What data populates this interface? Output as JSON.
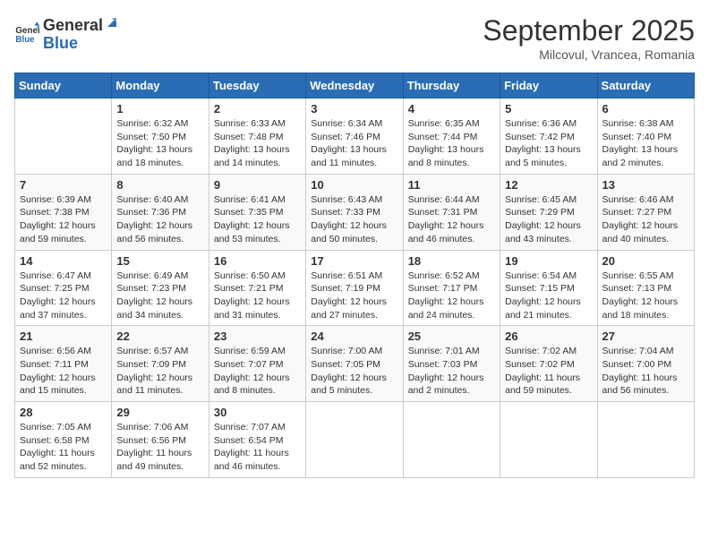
{
  "header": {
    "logo_general": "General",
    "logo_blue": "Blue",
    "month_title": "September 2025",
    "location": "Milcovul, Vrancea, Romania"
  },
  "days_of_week": [
    "Sunday",
    "Monday",
    "Tuesday",
    "Wednesday",
    "Thursday",
    "Friday",
    "Saturday"
  ],
  "weeks": [
    [
      {
        "day": "",
        "sunrise": "",
        "sunset": "",
        "daylight": ""
      },
      {
        "day": "1",
        "sunrise": "Sunrise: 6:32 AM",
        "sunset": "Sunset: 7:50 PM",
        "daylight": "Daylight: 13 hours and 18 minutes."
      },
      {
        "day": "2",
        "sunrise": "Sunrise: 6:33 AM",
        "sunset": "Sunset: 7:48 PM",
        "daylight": "Daylight: 13 hours and 14 minutes."
      },
      {
        "day": "3",
        "sunrise": "Sunrise: 6:34 AM",
        "sunset": "Sunset: 7:46 PM",
        "daylight": "Daylight: 13 hours and 11 minutes."
      },
      {
        "day": "4",
        "sunrise": "Sunrise: 6:35 AM",
        "sunset": "Sunset: 7:44 PM",
        "daylight": "Daylight: 13 hours and 8 minutes."
      },
      {
        "day": "5",
        "sunrise": "Sunrise: 6:36 AM",
        "sunset": "Sunset: 7:42 PM",
        "daylight": "Daylight: 13 hours and 5 minutes."
      },
      {
        "day": "6",
        "sunrise": "Sunrise: 6:38 AM",
        "sunset": "Sunset: 7:40 PM",
        "daylight": "Daylight: 13 hours and 2 minutes."
      }
    ],
    [
      {
        "day": "7",
        "sunrise": "Sunrise: 6:39 AM",
        "sunset": "Sunset: 7:38 PM",
        "daylight": "Daylight: 12 hours and 59 minutes."
      },
      {
        "day": "8",
        "sunrise": "Sunrise: 6:40 AM",
        "sunset": "Sunset: 7:36 PM",
        "daylight": "Daylight: 12 hours and 56 minutes."
      },
      {
        "day": "9",
        "sunrise": "Sunrise: 6:41 AM",
        "sunset": "Sunset: 7:35 PM",
        "daylight": "Daylight: 12 hours and 53 minutes."
      },
      {
        "day": "10",
        "sunrise": "Sunrise: 6:43 AM",
        "sunset": "Sunset: 7:33 PM",
        "daylight": "Daylight: 12 hours and 50 minutes."
      },
      {
        "day": "11",
        "sunrise": "Sunrise: 6:44 AM",
        "sunset": "Sunset: 7:31 PM",
        "daylight": "Daylight: 12 hours and 46 minutes."
      },
      {
        "day": "12",
        "sunrise": "Sunrise: 6:45 AM",
        "sunset": "Sunset: 7:29 PM",
        "daylight": "Daylight: 12 hours and 43 minutes."
      },
      {
        "day": "13",
        "sunrise": "Sunrise: 6:46 AM",
        "sunset": "Sunset: 7:27 PM",
        "daylight": "Daylight: 12 hours and 40 minutes."
      }
    ],
    [
      {
        "day": "14",
        "sunrise": "Sunrise: 6:47 AM",
        "sunset": "Sunset: 7:25 PM",
        "daylight": "Daylight: 12 hours and 37 minutes."
      },
      {
        "day": "15",
        "sunrise": "Sunrise: 6:49 AM",
        "sunset": "Sunset: 7:23 PM",
        "daylight": "Daylight: 12 hours and 34 minutes."
      },
      {
        "day": "16",
        "sunrise": "Sunrise: 6:50 AM",
        "sunset": "Sunset: 7:21 PM",
        "daylight": "Daylight: 12 hours and 31 minutes."
      },
      {
        "day": "17",
        "sunrise": "Sunrise: 6:51 AM",
        "sunset": "Sunset: 7:19 PM",
        "daylight": "Daylight: 12 hours and 27 minutes."
      },
      {
        "day": "18",
        "sunrise": "Sunrise: 6:52 AM",
        "sunset": "Sunset: 7:17 PM",
        "daylight": "Daylight: 12 hours and 24 minutes."
      },
      {
        "day": "19",
        "sunrise": "Sunrise: 6:54 AM",
        "sunset": "Sunset: 7:15 PM",
        "daylight": "Daylight: 12 hours and 21 minutes."
      },
      {
        "day": "20",
        "sunrise": "Sunrise: 6:55 AM",
        "sunset": "Sunset: 7:13 PM",
        "daylight": "Daylight: 12 hours and 18 minutes."
      }
    ],
    [
      {
        "day": "21",
        "sunrise": "Sunrise: 6:56 AM",
        "sunset": "Sunset: 7:11 PM",
        "daylight": "Daylight: 12 hours and 15 minutes."
      },
      {
        "day": "22",
        "sunrise": "Sunrise: 6:57 AM",
        "sunset": "Sunset: 7:09 PM",
        "daylight": "Daylight: 12 hours and 11 minutes."
      },
      {
        "day": "23",
        "sunrise": "Sunrise: 6:59 AM",
        "sunset": "Sunset: 7:07 PM",
        "daylight": "Daylight: 12 hours and 8 minutes."
      },
      {
        "day": "24",
        "sunrise": "Sunrise: 7:00 AM",
        "sunset": "Sunset: 7:05 PM",
        "daylight": "Daylight: 12 hours and 5 minutes."
      },
      {
        "day": "25",
        "sunrise": "Sunrise: 7:01 AM",
        "sunset": "Sunset: 7:03 PM",
        "daylight": "Daylight: 12 hours and 2 minutes."
      },
      {
        "day": "26",
        "sunrise": "Sunrise: 7:02 AM",
        "sunset": "Sunset: 7:02 PM",
        "daylight": "Daylight: 11 hours and 59 minutes."
      },
      {
        "day": "27",
        "sunrise": "Sunrise: 7:04 AM",
        "sunset": "Sunset: 7:00 PM",
        "daylight": "Daylight: 11 hours and 56 minutes."
      }
    ],
    [
      {
        "day": "28",
        "sunrise": "Sunrise: 7:05 AM",
        "sunset": "Sunset: 6:58 PM",
        "daylight": "Daylight: 11 hours and 52 minutes."
      },
      {
        "day": "29",
        "sunrise": "Sunrise: 7:06 AM",
        "sunset": "Sunset: 6:56 PM",
        "daylight": "Daylight: 11 hours and 49 minutes."
      },
      {
        "day": "30",
        "sunrise": "Sunrise: 7:07 AM",
        "sunset": "Sunset: 6:54 PM",
        "daylight": "Daylight: 11 hours and 46 minutes."
      },
      {
        "day": "",
        "sunrise": "",
        "sunset": "",
        "daylight": ""
      },
      {
        "day": "",
        "sunrise": "",
        "sunset": "",
        "daylight": ""
      },
      {
        "day": "",
        "sunrise": "",
        "sunset": "",
        "daylight": ""
      },
      {
        "day": "",
        "sunrise": "",
        "sunset": "",
        "daylight": ""
      }
    ]
  ]
}
